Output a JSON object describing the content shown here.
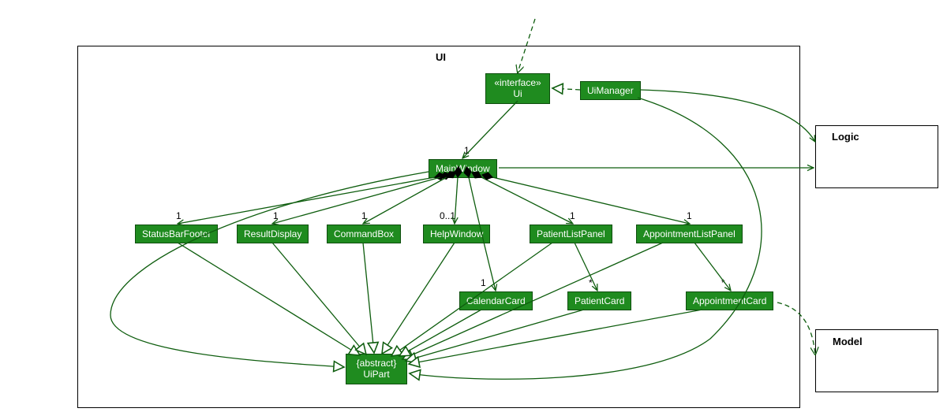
{
  "packages": {
    "ui_title": "UI",
    "logic_title": "Logic",
    "model_title": "Model"
  },
  "classes": {
    "ui_interface": {
      "stereotype": "«interface»",
      "name": "Ui"
    },
    "ui_manager": "UiManager",
    "main_window": "MainWindow",
    "status_bar_footer": "StatusBarFooter",
    "result_display": "ResultDisplay",
    "command_box": "CommandBox",
    "help_window": "HelpWindow",
    "patient_list_panel": "PatientListPanel",
    "appointment_list_panel": "AppointmentListPanel",
    "calendar_card": "CalendarCard",
    "patient_card": "PatientCard",
    "appointment_card": "AppointmentCard",
    "ui_part": {
      "stereotype": "{abstract}",
      "name": "UiPart"
    }
  },
  "multiplicities": {
    "main_window_mult": "1",
    "status_bar_footer_mult": "1",
    "result_display_mult": "1",
    "command_box_mult": "1",
    "help_window_mult": "0..1",
    "patient_list_panel_mult": "1",
    "appointment_list_panel_mult": "1",
    "calendar_card_mult": "1",
    "patient_card_mult": "*",
    "appointment_card_mult": "*"
  },
  "colors": {
    "class_fill": "#1f8b1f",
    "edge": "#0e5d0e"
  },
  "chart_data": {
    "type": "uml_class_diagram",
    "packages": [
      "UI",
      "Logic",
      "Model"
    ],
    "nodes": [
      {
        "id": "Ui",
        "package": "UI",
        "stereotype": "interface"
      },
      {
        "id": "UiManager",
        "package": "UI"
      },
      {
        "id": "MainWindow",
        "package": "UI"
      },
      {
        "id": "StatusBarFooter",
        "package": "UI"
      },
      {
        "id": "ResultDisplay",
        "package": "UI"
      },
      {
        "id": "CommandBox",
        "package": "UI"
      },
      {
        "id": "HelpWindow",
        "package": "UI"
      },
      {
        "id": "PatientListPanel",
        "package": "UI"
      },
      {
        "id": "AppointmentListPanel",
        "package": "UI"
      },
      {
        "id": "CalendarCard",
        "package": "UI"
      },
      {
        "id": "PatientCard",
        "package": "UI"
      },
      {
        "id": "AppointmentCard",
        "package": "UI"
      },
      {
        "id": "UiPart",
        "package": "UI",
        "stereotype": "abstract"
      },
      {
        "id": "Logic",
        "package": "Logic",
        "external_package": true
      },
      {
        "id": "Model",
        "package": "Model",
        "external_package": true
      }
    ],
    "edges": [
      {
        "from": "external",
        "to": "Ui",
        "kind": "dependency"
      },
      {
        "from": "UiManager",
        "to": "Ui",
        "kind": "realization"
      },
      {
        "from": "UiManager",
        "to": "MainWindow",
        "kind": "association",
        "mult_to": "1"
      },
      {
        "from": "UiManager",
        "to": "Logic",
        "kind": "association"
      },
      {
        "from": "MainWindow",
        "to": "Logic",
        "kind": "association"
      },
      {
        "from": "MainWindow",
        "to": "StatusBarFooter",
        "kind": "composition",
        "mult_to": "1"
      },
      {
        "from": "MainWindow",
        "to": "ResultDisplay",
        "kind": "composition",
        "mult_to": "1"
      },
      {
        "from": "MainWindow",
        "to": "CommandBox",
        "kind": "composition",
        "mult_to": "1"
      },
      {
        "from": "MainWindow",
        "to": "HelpWindow",
        "kind": "composition",
        "mult_to": "0..1"
      },
      {
        "from": "MainWindow",
        "to": "PatientListPanel",
        "kind": "composition",
        "mult_to": "1"
      },
      {
        "from": "MainWindow",
        "to": "AppointmentListPanel",
        "kind": "composition",
        "mult_to": "1"
      },
      {
        "from": "MainWindow",
        "to": "CalendarCard",
        "kind": "composition",
        "mult_to": "1"
      },
      {
        "from": "PatientListPanel",
        "to": "PatientCard",
        "kind": "association",
        "mult_to": "*"
      },
      {
        "from": "AppointmentListPanel",
        "to": "AppointmentCard",
        "kind": "association",
        "mult_to": "*"
      },
      {
        "from": "AppointmentCard",
        "to": "Model",
        "kind": "dependency"
      },
      {
        "from": "MainWindow",
        "to": "UiPart",
        "kind": "generalization"
      },
      {
        "from": "UiManager",
        "to": "UiPart",
        "kind": "generalization"
      },
      {
        "from": "StatusBarFooter",
        "to": "UiPart",
        "kind": "generalization"
      },
      {
        "from": "ResultDisplay",
        "to": "UiPart",
        "kind": "generalization"
      },
      {
        "from": "CommandBox",
        "to": "UiPart",
        "kind": "generalization"
      },
      {
        "from": "HelpWindow",
        "to": "UiPart",
        "kind": "generalization"
      },
      {
        "from": "PatientListPanel",
        "to": "UiPart",
        "kind": "generalization"
      },
      {
        "from": "AppointmentListPanel",
        "to": "UiPart",
        "kind": "generalization"
      },
      {
        "from": "CalendarCard",
        "to": "UiPart",
        "kind": "generalization"
      },
      {
        "from": "PatientCard",
        "to": "UiPart",
        "kind": "generalization"
      },
      {
        "from": "AppointmentCard",
        "to": "UiPart",
        "kind": "generalization"
      }
    ]
  }
}
